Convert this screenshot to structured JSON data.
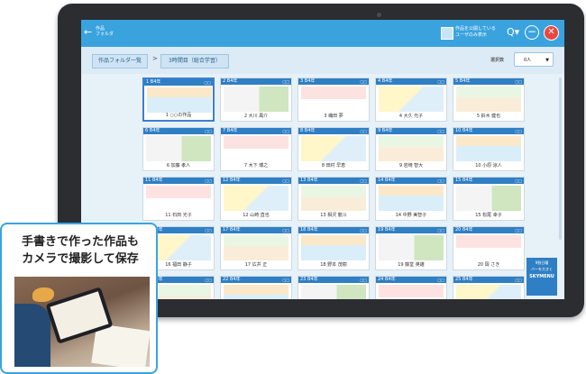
{
  "app": {
    "back_label": "作品\nフォルダ",
    "publish_label": "作品を公開している\nユーザのみ表示",
    "colors": {
      "topbar": "#3aa3de",
      "close": "#e8483f",
      "card_head": "#2f7fc4"
    }
  },
  "breadcrumb": {
    "root": "作品フォルダ一覧",
    "separator": ">",
    "current": "3時間目（総合学習）"
  },
  "selector": {
    "label": "選択数",
    "value": "0人"
  },
  "works": [
    {
      "num": "1 B4年",
      "name": "1 ○○の作品"
    },
    {
      "num": "2 B4年",
      "name": "2 大川 風介"
    },
    {
      "num": "3 B4年",
      "name": "3 織田 夢"
    },
    {
      "num": "4 B4年",
      "name": "4 大久 光子"
    },
    {
      "num": "5 B4年",
      "name": "5 鈴木 健也"
    },
    {
      "num": "6 B4年",
      "name": "6 加藤 孝人"
    },
    {
      "num": "7 B4年",
      "name": "7 木下 博之"
    },
    {
      "num": "8 B4年",
      "name": "8 田村 早恵"
    },
    {
      "num": "9 B4年",
      "name": "9 岩崎 智大"
    },
    {
      "num": "10 B4年",
      "name": "10 小原 涼人"
    },
    {
      "num": "11 B4年",
      "name": "11 石田 光子"
    },
    {
      "num": "12 B4年",
      "name": "12 山崎 直也"
    },
    {
      "num": "13 B4年",
      "name": "13 相沢 龍斗"
    },
    {
      "num": "14 B4年",
      "name": "14 中野 美智子"
    },
    {
      "num": "15 B4年",
      "name": "15 松尾 幸子"
    },
    {
      "num": "16 B4年",
      "name": "16 福田 静子"
    },
    {
      "num": "17 B4年",
      "name": "17 広井 正"
    },
    {
      "num": "18 B4年",
      "name": "18 野本 茂樹"
    },
    {
      "num": "19 B4年",
      "name": "19 藤堂 英雄"
    },
    {
      "num": "20 B4年",
      "name": "20 岡 さき"
    },
    {
      "num": "21 B4年",
      "name": ""
    },
    {
      "num": "22 B4年",
      "name": ""
    },
    {
      "num": "23 B4年",
      "name": ""
    },
    {
      "num": "24 B4年",
      "name": ""
    },
    {
      "num": "25 B4年",
      "name": ""
    }
  ],
  "right_button": {
    "top": "9割日曜",
    "main": "バーを大きく",
    "logo": "SKYMENU"
  },
  "callout": {
    "line1": "手書きで作った作品も",
    "line2": "カメラで撮影して保存"
  }
}
